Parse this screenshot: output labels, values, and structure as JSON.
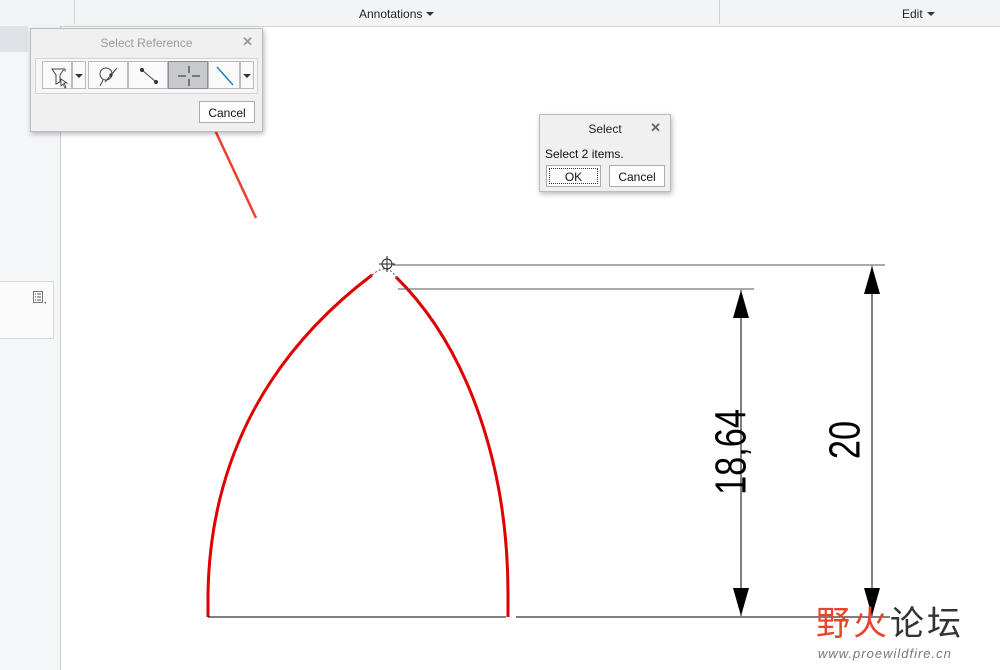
{
  "ribbon": {
    "groups": [
      {
        "label": "Annotations"
      },
      {
        "label": "Edit"
      }
    ]
  },
  "select_reference_dialog": {
    "title": "Select Reference",
    "close_symbol": "✕",
    "tools": [
      {
        "icon": "filter-select-icon",
        "state": "normal"
      },
      {
        "icon": "curve-reference-icon",
        "state": "normal"
      },
      {
        "icon": "edge-reference-icon",
        "state": "normal"
      },
      {
        "icon": "intersection-point-icon",
        "state": "active"
      },
      {
        "icon": "line-reference-icon",
        "state": "normal"
      }
    ],
    "cancel_label": "Cancel"
  },
  "select_dialog": {
    "title": "Select",
    "close_symbol": "✕",
    "message": "Select 2 items.",
    "ok_label": "OK",
    "cancel_label": "Cancel"
  },
  "drawing": {
    "dimensions": [
      {
        "value": "18,64"
      },
      {
        "value": "20"
      }
    ],
    "profile_color": "#e00000",
    "dimension_color": "#000000",
    "annotation_arrow_color": "#e8432c"
  },
  "watermark": {
    "text_red": "野火",
    "text_dark": "论坛",
    "url": "www.proewildfire.cn"
  }
}
